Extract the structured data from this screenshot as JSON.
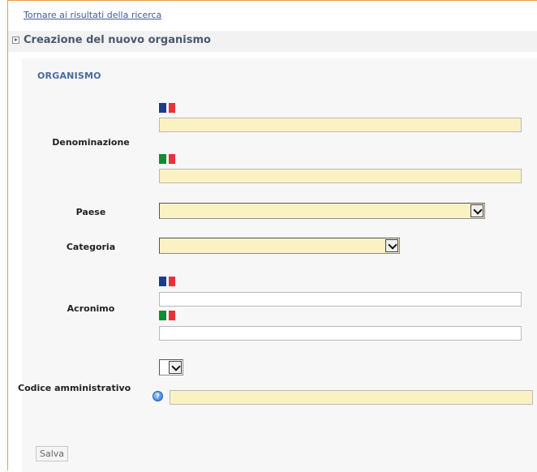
{
  "back_link": "Tornare ai risultati della ricerca",
  "section_title": "Creazione del nuovo organismo",
  "sub_heading": "ORGANISMO",
  "fields": {
    "denominazione": {
      "label": "Denominazione",
      "fr_value": "",
      "it_value": ""
    },
    "paese": {
      "label": "Paese",
      "selected": ""
    },
    "categoria": {
      "label": "Categoria",
      "selected": ""
    },
    "acronimo": {
      "label": "Acronimo",
      "fr_value": "",
      "it_value": ""
    },
    "codice_amministrativo": {
      "label": "Codice amministrativo",
      "selected": "",
      "value": ""
    }
  },
  "buttons": {
    "save": "Salva"
  },
  "icons": {
    "expand": "expand-icon",
    "flag_fr": "flag-fr-icon",
    "flag_it": "flag-it-icon",
    "help": "help-icon",
    "dropdown": "chevron-down-icon"
  },
  "colors": {
    "required_field_bg": "#fbf2c4",
    "link": "#3d5d9e",
    "heading": "#4a6a9e",
    "frame_border": "#e8a050"
  }
}
